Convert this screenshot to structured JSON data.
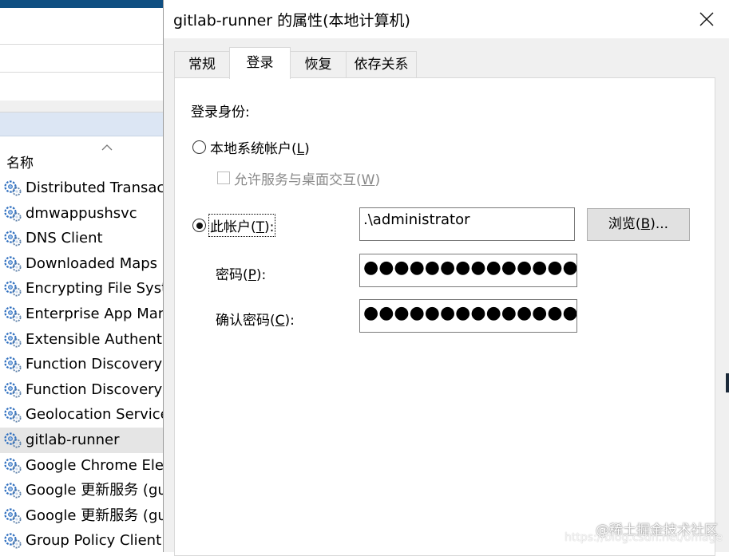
{
  "background_window": {
    "column_header": "名称",
    "services": [
      "Distributed Transaction Coordinator",
      "dmwappushsvc",
      "DNS Client",
      "Downloaded Maps Manager",
      "Encrypting File System (EFS)",
      "Enterprise App Management Service",
      "Extensible Authentication Protocol",
      "Function Discovery Provider Host",
      "Function Discovery Resource Publication",
      "Geolocation Service",
      "gitlab-runner",
      "Google Chrome Elevation Service",
      "Google 更新服务 (gupdate)",
      "Google 更新服务 (gupdatem)",
      "Group Policy Client"
    ],
    "selected_service": "gitlab-runner"
  },
  "dialog": {
    "title": "gitlab-runner 的属性(本地计算机)",
    "tabs": [
      "常规",
      "登录",
      "恢复",
      "依存关系"
    ],
    "active_tab": "登录",
    "logon_as_label": "登录身份:",
    "local_system": {
      "text": "本地系统帐户(",
      "key": "L",
      "end": ")"
    },
    "desktop_interact": {
      "text": "允许服务与桌面交互(",
      "key": "W",
      "end": ")"
    },
    "this_account": {
      "text": "此帐户(",
      "key": "T",
      "end": "):"
    },
    "account_value": ".\\administrator",
    "browse": {
      "text": "浏览(",
      "key": "B",
      "end": ")..."
    },
    "password": {
      "text": "密码(",
      "key": "P",
      "end": "):"
    },
    "password_value": "●●●●●●●●●●●●●●●",
    "confirm": {
      "text": "确认密码(",
      "key": "C",
      "end": "):"
    },
    "confirm_value": "●●●●●●●●●●●●●●●"
  },
  "watermark": {
    "text": "@稀土掘金技术社区",
    "url": "https://blog.csdn.net/omage"
  },
  "colors": {
    "dialog_bg": "#f0f0f0",
    "panel_bg": "#ffffff",
    "selection": "#e5e5e5",
    "header_blue": "#dce6f4",
    "gear_blue": "#2f6fbf"
  },
  "selected_radio": "this_account"
}
